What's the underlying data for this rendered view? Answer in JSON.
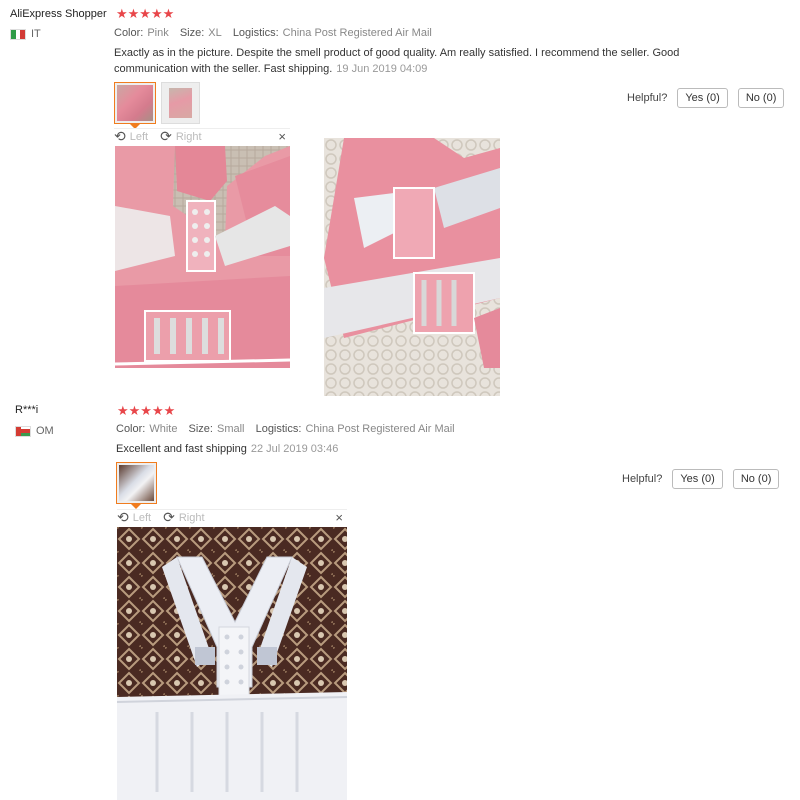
{
  "reviews": [
    {
      "name": "AliExpress Shopper",
      "stars": "★★★★★",
      "country": "IT",
      "attrs": [
        {
          "label": "Color:",
          "value": "Pink"
        },
        {
          "label": "Size:",
          "value": "XL"
        },
        {
          "label": "Logistics:",
          "value": "China Post Registered Air Mail"
        }
      ],
      "text_line1": "Exactly as in the picture. Despite the smell product of good quality. Am really satisfied. I recommend the seller. Good",
      "text_line2": "communication with the seller. Fast shipping.",
      "date": "19 Jun 2019 04:09",
      "helpful_label": "Helpful?",
      "yes_label": "Yes (0)",
      "no_label": "No (0)",
      "viewer": {
        "left": "Left",
        "right": "Right",
        "close": "×"
      }
    },
    {
      "name": "R***i",
      "stars": "★★★★★",
      "country": "OM",
      "attrs": [
        {
          "label": "Color:",
          "value": "White"
        },
        {
          "label": "Size:",
          "value": "Small"
        },
        {
          "label": "Logistics:",
          "value": "China Post Registered Air Mail"
        }
      ],
      "text_line1": "Excellent and fast shipping",
      "date": "22 Jul 2019 03:46",
      "helpful_label": "Helpful?",
      "yes_label": "Yes (0)",
      "no_label": "No (0)",
      "viewer": {
        "left": "Left",
        "right": "Right",
        "close": "×"
      }
    }
  ],
  "icons": {
    "rotate_left": "rotate-left-icon",
    "rotate_right": "rotate-right-icon",
    "close": "close-icon"
  },
  "colors": {
    "star": "#e8464a",
    "active_thumb": "#f07c1e",
    "pink_product": "#e9899a",
    "white_product": "#e8eaf0"
  }
}
